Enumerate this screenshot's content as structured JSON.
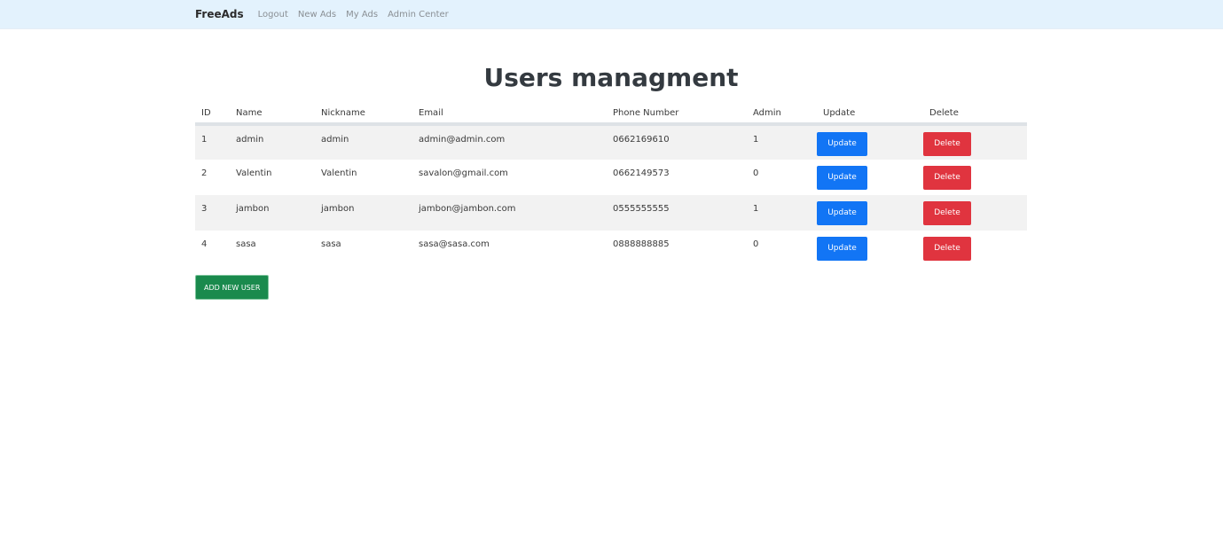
{
  "navbar": {
    "brand": "FreeAds",
    "links": [
      "Logout",
      "New Ads",
      "My Ads",
      "Admin Center"
    ]
  },
  "page": {
    "title": "Users managment"
  },
  "table": {
    "headers": [
      "ID",
      "Name",
      "Nickname",
      "Email",
      "Phone Number",
      "Admin",
      "Update",
      "Delete"
    ],
    "rows": [
      {
        "id": "1",
        "name": "admin",
        "nickname": "admin",
        "email": "admin@admin.com",
        "phone": "0662169610",
        "admin": "1",
        "update": "Update",
        "delete": "Delete"
      },
      {
        "id": "2",
        "name": "Valentin",
        "nickname": "Valentin",
        "email": "savalon@gmail.com",
        "phone": "0662149573",
        "admin": "0",
        "update": "Update",
        "delete": "Delete"
      },
      {
        "id": "3",
        "name": "jambon",
        "nickname": "jambon",
        "email": "jambon@jambon.com",
        "phone": "0555555555",
        "admin": "1",
        "update": "Update",
        "delete": "Delete"
      },
      {
        "id": "4",
        "name": "sasa",
        "nickname": "sasa",
        "email": "sasa@sasa.com",
        "phone": "0888888885",
        "admin": "0",
        "update": "Update",
        "delete": "Delete"
      }
    ]
  },
  "actions": {
    "add_user": "ADD NEW USER"
  },
  "colors": {
    "navbar_bg": "#e3f2fd",
    "update": "#1275f5",
    "delete": "#e0343f",
    "add": "#1a8a4d"
  }
}
